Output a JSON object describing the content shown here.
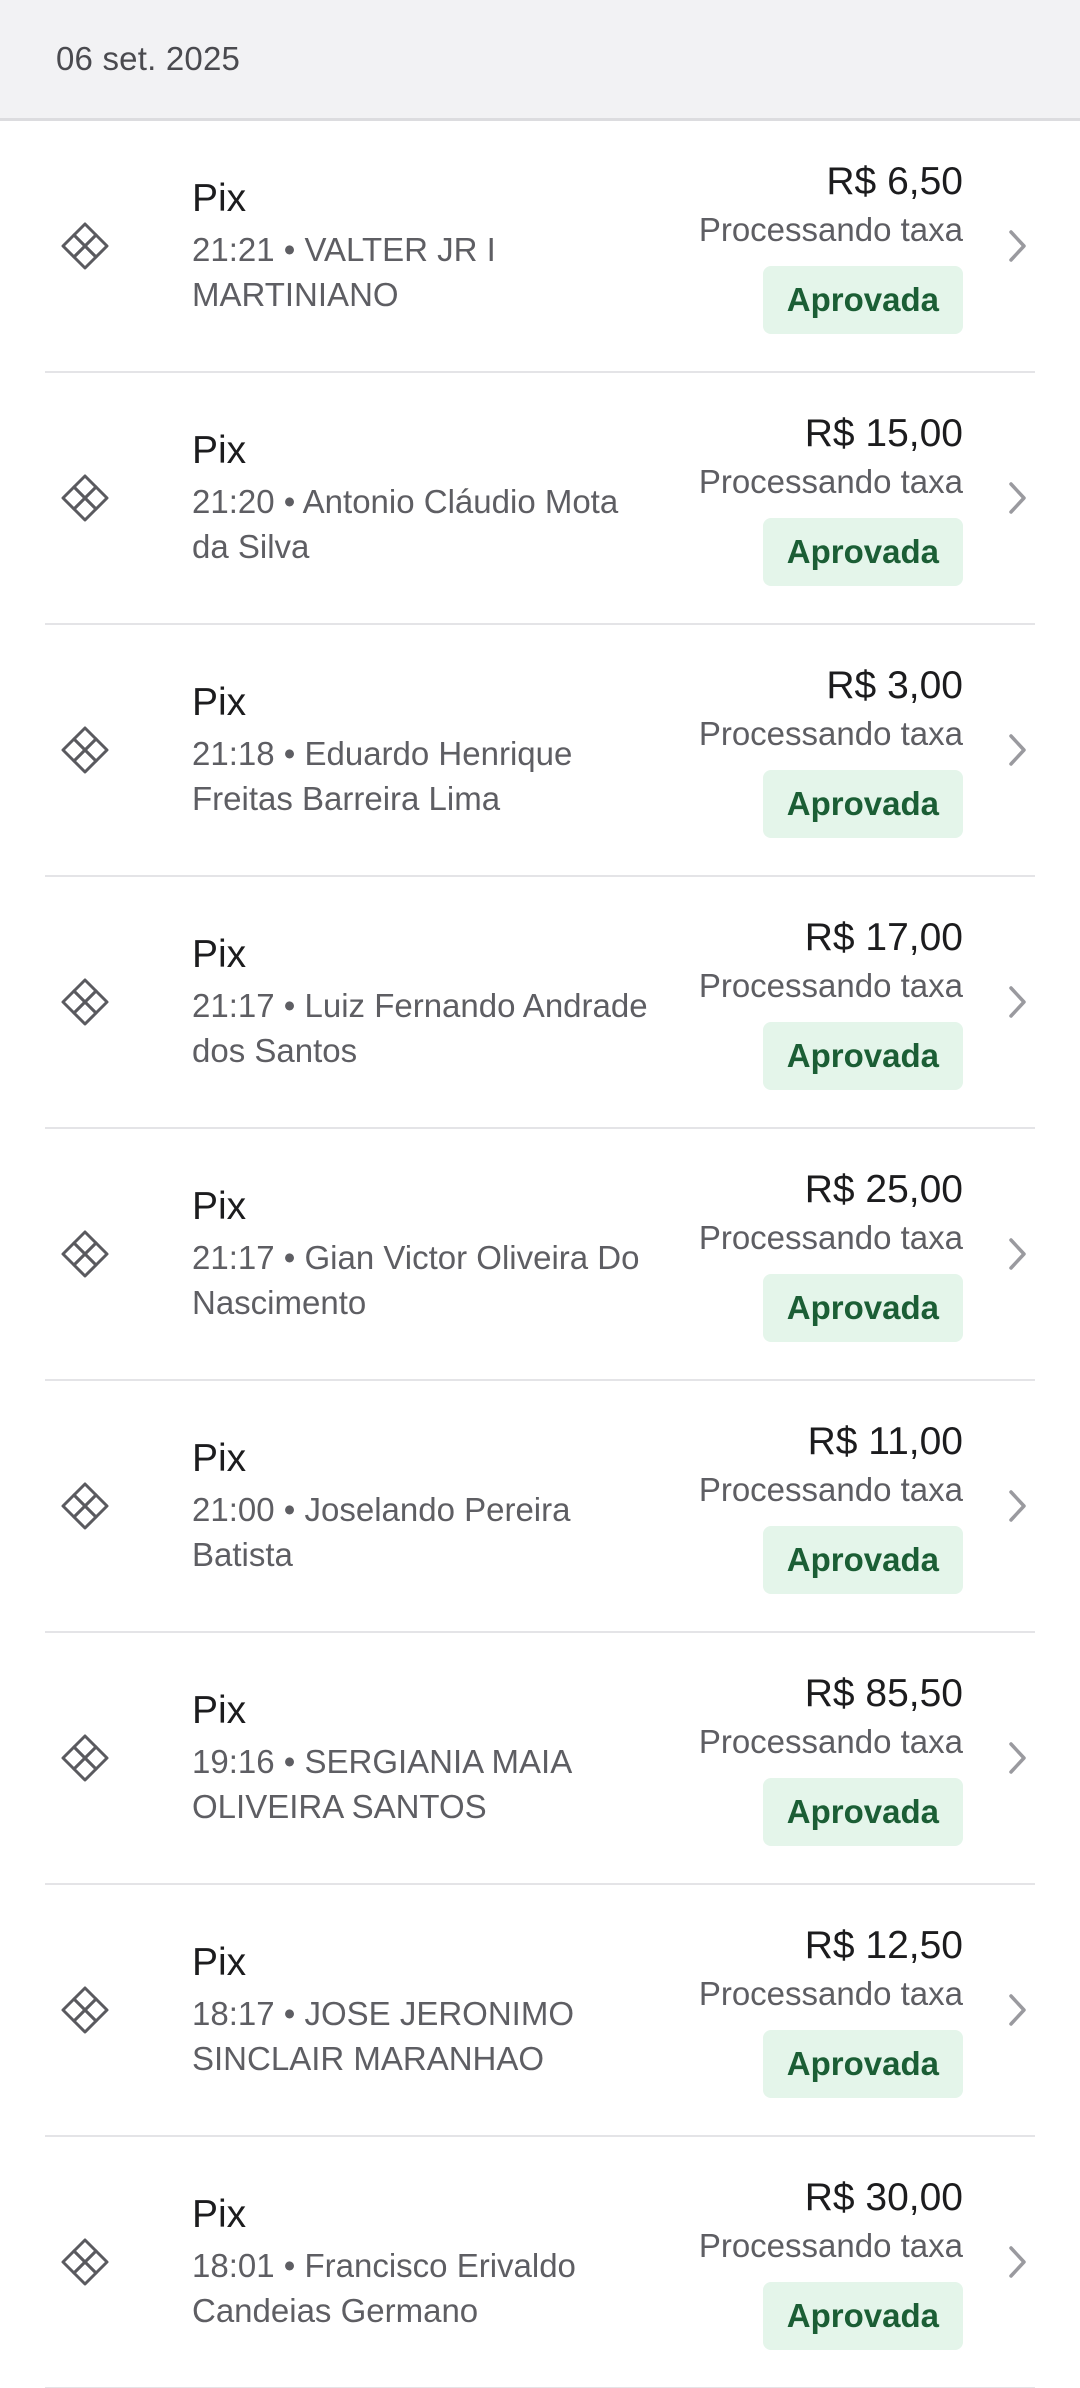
{
  "header": {
    "date": "06 set. 2025"
  },
  "icons": {
    "payment": "pix-icon",
    "chevron": "chevron-right-icon"
  },
  "colors": {
    "status_bg": "#e4f5ea",
    "status_text": "#1b5e35"
  },
  "transactions": [
    {
      "type": "Pix",
      "time": "21:21",
      "name": "VALTER JR I MARTINIANO",
      "amount": "R$ 6,50",
      "fee": "Processando taxa",
      "status": "Aprovada"
    },
    {
      "type": "Pix",
      "time": "21:20",
      "name": "Antonio Cláudio Mota da Silva",
      "amount": "R$ 15,00",
      "fee": "Processando taxa",
      "status": "Aprovada"
    },
    {
      "type": "Pix",
      "time": "21:18",
      "name": "Eduardo Henrique Freitas Barreira Lima",
      "amount": "R$ 3,00",
      "fee": "Processando taxa",
      "status": "Aprovada"
    },
    {
      "type": "Pix",
      "time": "21:17",
      "name": "Luiz Fernando Andrade dos Santos",
      "amount": "R$ 17,00",
      "fee": "Processando taxa",
      "status": "Aprovada"
    },
    {
      "type": "Pix",
      "time": "21:17",
      "name": "Gian Victor Oliveira Do Nascimento",
      "amount": "R$ 25,00",
      "fee": "Processando taxa",
      "status": "Aprovada"
    },
    {
      "type": "Pix",
      "time": "21:00",
      "name": "Joselando Pereira Batista",
      "amount": "R$ 11,00",
      "fee": "Processando taxa",
      "status": "Aprovada"
    },
    {
      "type": "Pix",
      "time": "19:16",
      "name": "SERGIANIA MAIA OLIVEIRA SANTOS",
      "amount": "R$ 85,50",
      "fee": "Processando taxa",
      "status": "Aprovada"
    },
    {
      "type": "Pix",
      "time": "18:17",
      "name": "JOSE JERONIMO SINCLAIR MARANHAO",
      "amount": "R$ 12,50",
      "fee": "Processando taxa",
      "status": "Aprovada"
    },
    {
      "type": "Pix",
      "time": "18:01",
      "name": "Francisco Erivaldo Candeias Germano",
      "amount": "R$ 30,00",
      "fee": "Processando taxa",
      "status": "Aprovada"
    }
  ]
}
